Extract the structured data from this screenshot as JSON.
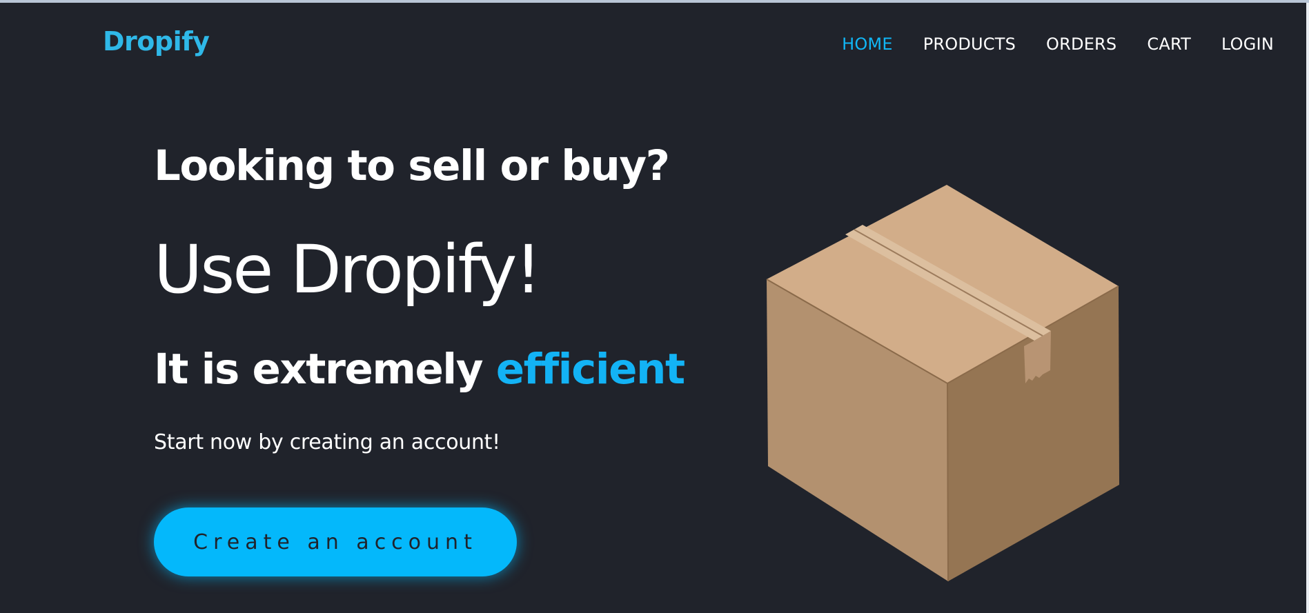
{
  "brand": {
    "name": "Dropify",
    "color": "#2fb8e8"
  },
  "nav": {
    "items": [
      {
        "label": "HOME",
        "active": true
      },
      {
        "label": "PRODUCTS",
        "active": false
      },
      {
        "label": "ORDERS",
        "active": false
      },
      {
        "label": "CART",
        "active": false
      },
      {
        "label": "LOGIN",
        "active": false
      }
    ],
    "active_color": "#11b6f5"
  },
  "hero": {
    "question": "Looking to sell or buy?",
    "headline": "Use Dropify!",
    "claim_prefix": "It is extremely ",
    "claim_accent": "efficient",
    "tagline": "Start now by creating an account!",
    "cta_label": "Create an account",
    "illustration": "cardboard-box-icon"
  },
  "colors": {
    "background": "#20232b",
    "accent": "#04b8fb",
    "text": "#ffffff"
  }
}
